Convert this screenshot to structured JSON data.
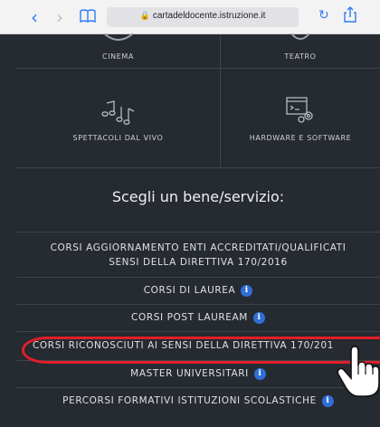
{
  "browser": {
    "url": "cartadeldocente.istruzione.it",
    "icons": [
      "back-icon",
      "forward-icon",
      "bookmarks-icon",
      "lock-icon",
      "reload-icon",
      "share-icon"
    ]
  },
  "categories": [
    {
      "label": "CINEMA",
      "icon": "cinema-icon"
    },
    {
      "label": "TEATRO",
      "icon": "theatre-icon"
    },
    {
      "label": "SPETTACOLI DAL VIVO",
      "icon": "music-notes-icon"
    },
    {
      "label": "HARDWARE E SOFTWARE",
      "icon": "hardware-software-icon"
    }
  ],
  "heading": "Scegli un bene/servizio:",
  "services": [
    {
      "line1": "CORSI AGGIORNAMENTO ENTI ACCREDITATI/QUALIFICATI",
      "line2": "SENSI DELLA DIRETTIVA 170/2016",
      "info": false
    },
    {
      "line1": "CORSI DI LAUREA",
      "info": true
    },
    {
      "line1": "CORSI POST LAUREAM",
      "info": true
    },
    {
      "line1": "CORSI RICONOSCIUTI AI SENSI DELLA DIRETTIVA 170/201",
      "info": false,
      "highlighted": true
    },
    {
      "line1": "MASTER UNIVERSITARI",
      "info": true
    },
    {
      "line1": "PERCORSI FORMATIVI ISTITUZIONI SCOLASTICHE",
      "info": true
    }
  ],
  "info_symbol": "i",
  "colors": {
    "background": "#262a31",
    "accent": "#2f6fd6",
    "highlight": "#e01f2a"
  }
}
